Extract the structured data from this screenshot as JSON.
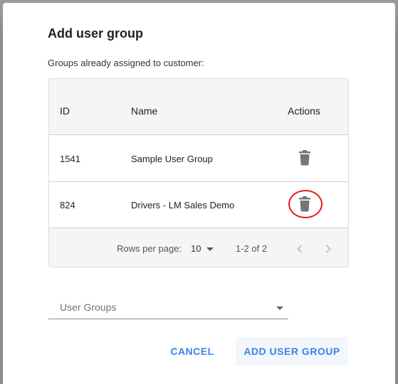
{
  "dialog": {
    "title": "Add user group",
    "subtitle": "Groups already assigned to customer:"
  },
  "table": {
    "columns": [
      "ID",
      "Name",
      "Actions"
    ],
    "rows": [
      {
        "id": "1541",
        "name": "Sample User Group",
        "action_icon": "trash-icon"
      },
      {
        "id": "824",
        "name": "Drivers - LM Sales Demo",
        "action_icon": "trash-icon"
      }
    ],
    "pagination": {
      "rows_per_page_label": "Rows per page:",
      "rows_per_page_value": "10",
      "range": "1-2 of 2"
    }
  },
  "select": {
    "label": "User Groups"
  },
  "actions": {
    "cancel": "CANCEL",
    "add": "ADD USER GROUP"
  },
  "colors": {
    "accent": "#3b83e8",
    "highlight": "#e21f1f",
    "icon": "#757575"
  }
}
